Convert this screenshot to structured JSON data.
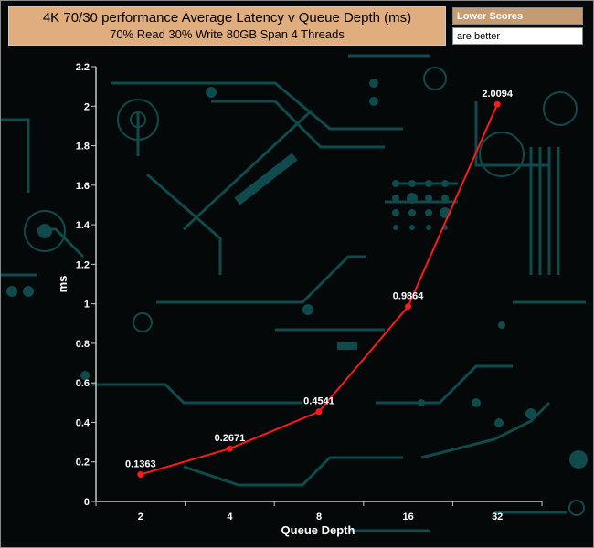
{
  "chart_data": {
    "type": "line",
    "title": "4K 70/30 performance Average Latency v Queue Depth (ms)",
    "subtitle": "70% Read 30% Write 80GB Span 4 Threads",
    "xlabel": "Queue Depth",
    "ylabel": "ms",
    "categories": [
      "2",
      "4",
      "8",
      "16",
      "32"
    ],
    "series": [
      {
        "values": [
          0.1363,
          0.2671,
          0.4541,
          0.9864,
          2.0094
        ],
        "color": "#ff1a1a"
      }
    ],
    "data_labels": [
      "0.1363",
      "0.2671",
      "0.4541",
      "0.9864",
      "2.0094"
    ],
    "ylim": [
      0,
      2.2
    ],
    "yticks": [
      0,
      0.2,
      0.4,
      0.6,
      0.8,
      1,
      1.2,
      1.4,
      1.6,
      1.8,
      2,
      2.2
    ],
    "ytick_labels": [
      "0",
      "0.2",
      "0.4",
      "0.6",
      "0.8",
      "1",
      "1.2",
      "1.4",
      "1.6",
      "1.8",
      "2",
      "2.2"
    ],
    "grid": false,
    "legend": {
      "heading": "Lower Scores",
      "text": "are better",
      "position": "top-right"
    }
  },
  "colors": {
    "title_background": "#e0ad7f",
    "legend_heading_background": "#c59b72",
    "plot_background": "#050808",
    "circuit_pattern": "#0f4a4c",
    "axis": "#c8c8c8"
  }
}
